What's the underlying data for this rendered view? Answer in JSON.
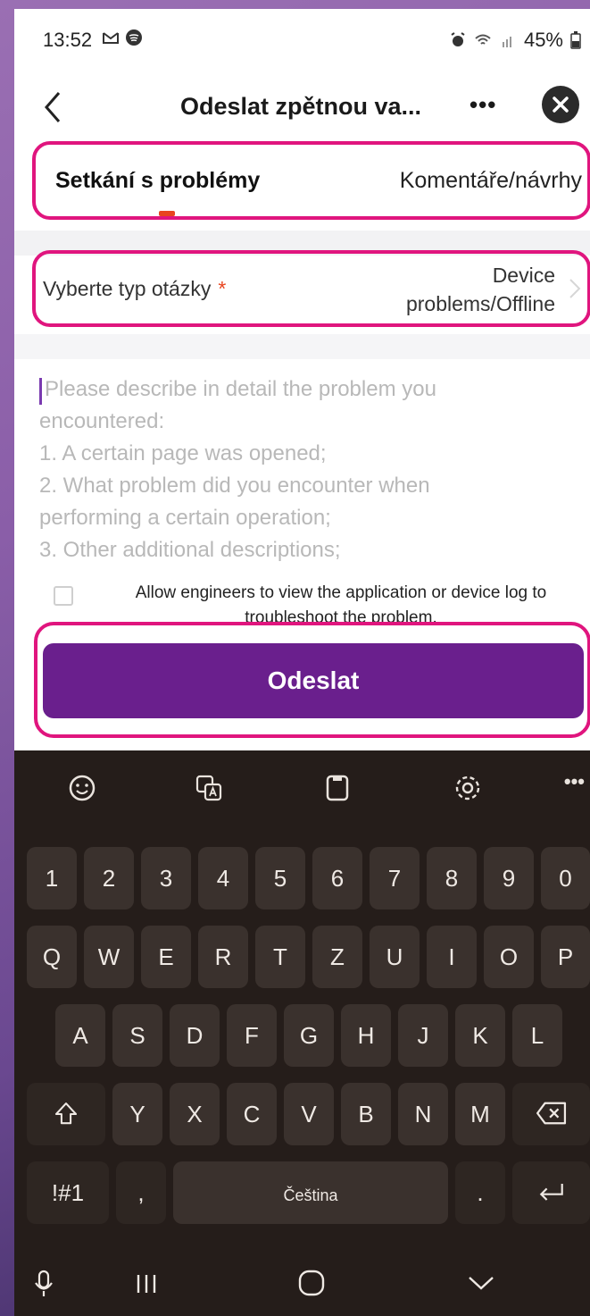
{
  "status_bar": {
    "time": "13:52",
    "battery": "45%"
  },
  "header": {
    "title": "Odeslat zpětnou va...",
    "more": "•••"
  },
  "tabs": [
    {
      "label": "Setkání s problémy",
      "active": true
    },
    {
      "label": "Komentáře/návrhy",
      "active": false
    }
  ],
  "question_type": {
    "label": "Vyberte typ otázky",
    "required_mark": "*",
    "value_line1": "Device",
    "value_line2": "problems/Offline"
  },
  "description": {
    "placeholder_lines": [
      "Please describe in detail the problem you",
      "encountered:",
      "1. A certain page was opened;",
      "2. What problem did you encounter when",
      "performing a certain operation;",
      "3. Other additional descriptions;"
    ]
  },
  "consent": {
    "text": "Allow engineers to view the application or device log to troubleshoot the problem."
  },
  "submit": {
    "label": "Odeslat"
  },
  "keyboard": {
    "number_row": [
      "1",
      "2",
      "3",
      "4",
      "5",
      "6",
      "7",
      "8",
      "9",
      "0"
    ],
    "row1": [
      "Q",
      "W",
      "E",
      "R",
      "T",
      "Z",
      "U",
      "I",
      "O",
      "P"
    ],
    "row2": [
      "A",
      "S",
      "D",
      "F",
      "G",
      "H",
      "J",
      "K",
      "L"
    ],
    "row3": [
      "Y",
      "X",
      "C",
      "V",
      "B",
      "N",
      "M"
    ],
    "symbols_label": "!#1",
    "comma": ",",
    "space_label": "Čeština",
    "period": "."
  },
  "colors": {
    "accent": "#6a1f8d",
    "highlight": "#e0157e",
    "indicator": "#e8451f"
  }
}
